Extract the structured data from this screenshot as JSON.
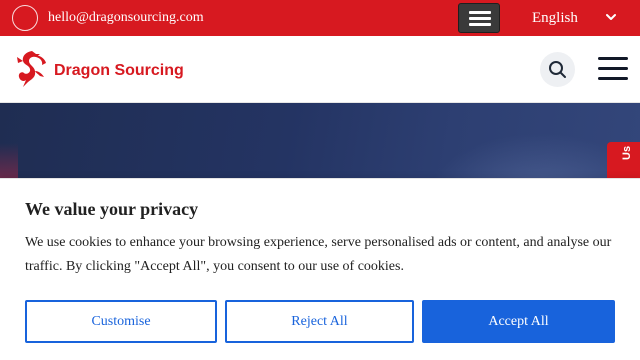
{
  "topbar": {
    "email": "hello@dragonsourcing.com",
    "mail_icon_glyph": "",
    "language": "English",
    "background_color": "#d71920"
  },
  "header": {
    "logo_text": "Dragon Sourcing",
    "brand_color": "#d71920",
    "icons": [
      "dragon-logo-icon",
      "search-icon",
      "hamburger-menu-icon"
    ]
  },
  "side_tab": {
    "label": "Us"
  },
  "cookie_banner": {
    "title": "We value your privacy",
    "description": "We use cookies to enhance your browsing experience, serve personalised ads or content, and analyse our traffic. By clicking \"Accept All\", you consent to our use of cookies.",
    "customise_label": "Customise",
    "reject_label": "Reject All",
    "accept_label": "Accept All",
    "accent_color": "#1863dc"
  }
}
